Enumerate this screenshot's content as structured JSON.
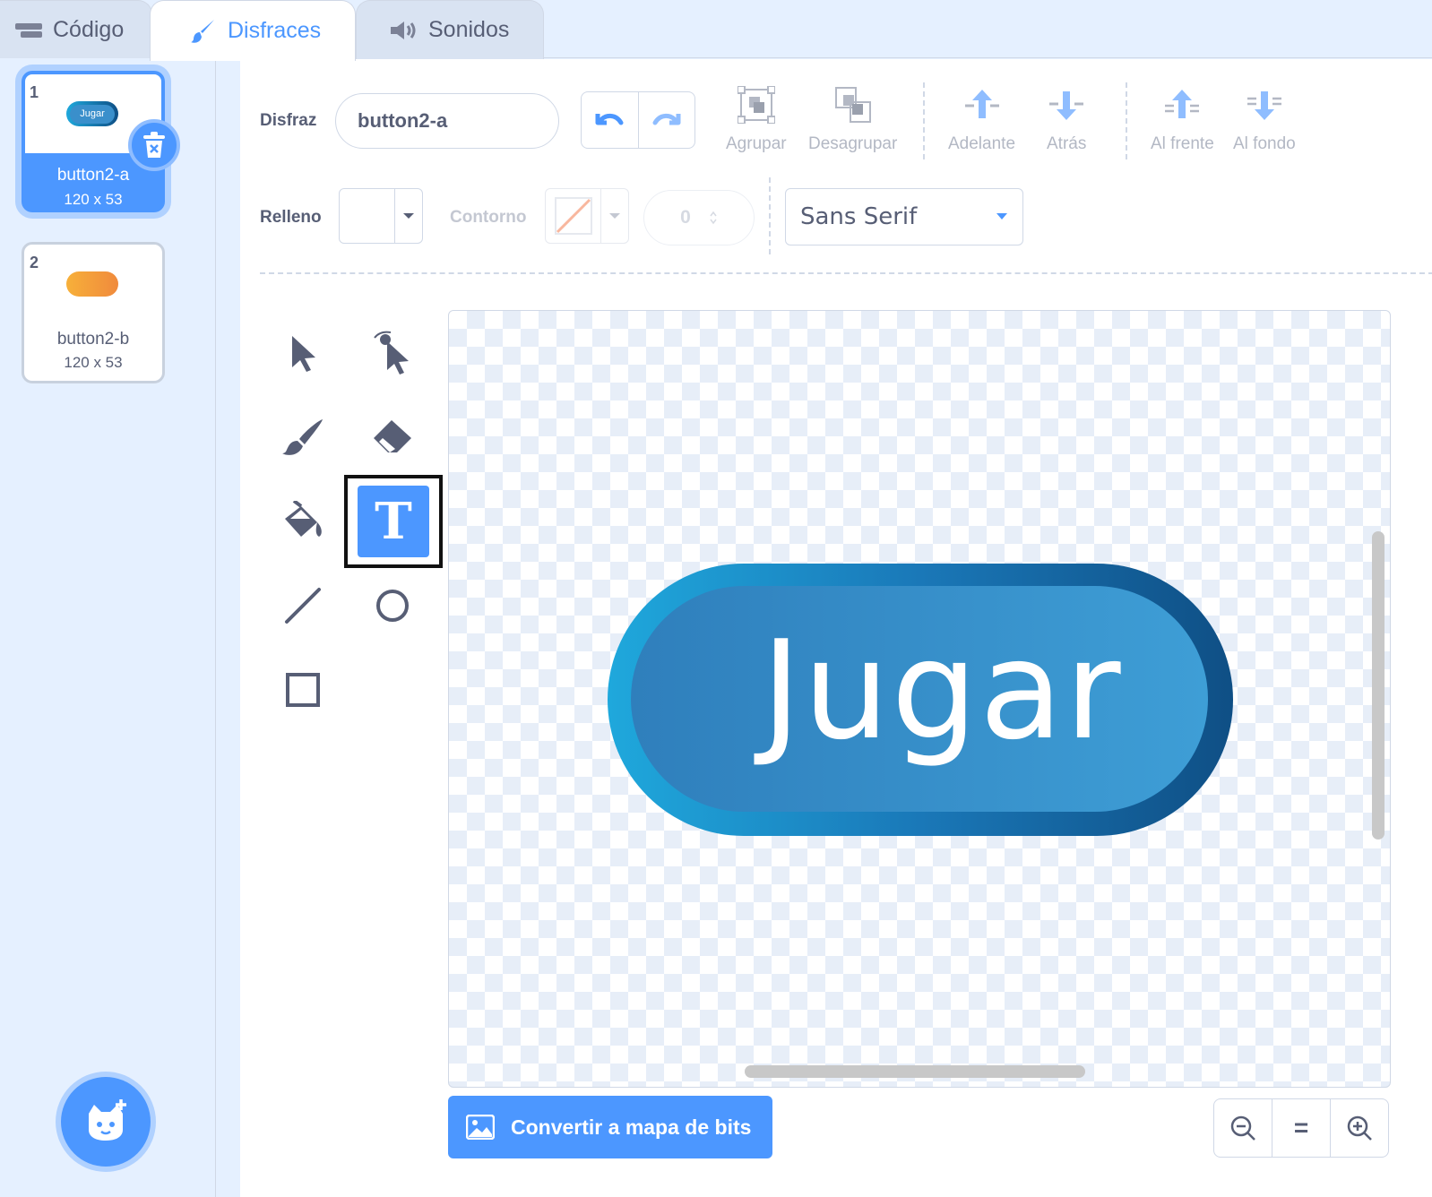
{
  "tabs": [
    {
      "label": "Código",
      "icon": "code-icon"
    },
    {
      "label": "Disfraces",
      "icon": "brush-icon"
    },
    {
      "label": "Sonidos",
      "icon": "speaker-icon"
    }
  ],
  "costumes": [
    {
      "number": "1",
      "name": "button2-a",
      "size": "120 x 53",
      "thumb_text": "Jugar",
      "selected": true
    },
    {
      "number": "2",
      "name": "button2-b",
      "size": "120 x 53",
      "selected": false
    }
  ],
  "toolbar": {
    "costume_label": "Disfraz",
    "costume_name": "button2-a",
    "group": "Agrupar",
    "ungroup": "Desagrupar",
    "forward": "Adelante",
    "backward": "Atrás",
    "front": "Al frente",
    "back": "Al fondo",
    "fill_label": "Relleno",
    "outline_label": "Contorno",
    "outline_width": "0",
    "font": "Sans Serif"
  },
  "tools": [
    "select-icon",
    "reshape-icon",
    "brush-icon",
    "eraser-icon",
    "fill-icon",
    "text-icon",
    "line-icon",
    "circle-icon",
    "rectangle-icon"
  ],
  "active_tool": "text",
  "text_tool_glyph": "T",
  "canvas": {
    "button_text": "Jugar"
  },
  "convert_button": "Convertir a mapa de bits",
  "zoom": {
    "zoom_out": "−",
    "reset": "=",
    "zoom_in": "+"
  },
  "colors": {
    "accent": "#4c97ff",
    "button_light": "#1fa8dc",
    "button_dark": "#0f4f85",
    "orange_costume": "#f7a13a"
  }
}
